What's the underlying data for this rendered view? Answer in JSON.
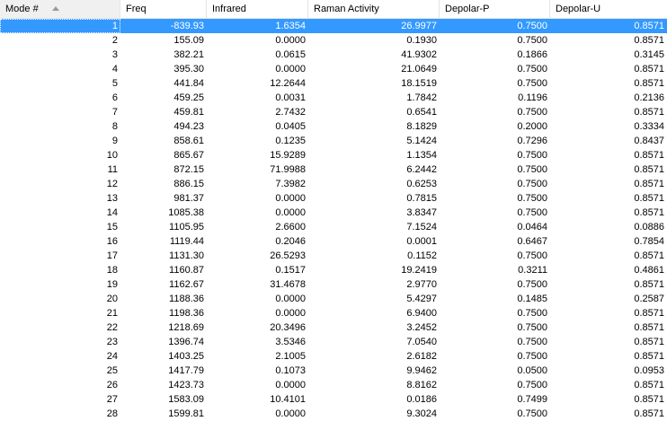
{
  "columns": [
    "Mode #",
    "Freq",
    "Infrared",
    "Raman Activity",
    "Depolar-P",
    "Depolar-U"
  ],
  "selected_row": 0,
  "rows": [
    [
      "1",
      "-839.93",
      "1.6354",
      "26.9977",
      "0.7500",
      "0.8571"
    ],
    [
      "2",
      "155.09",
      "0.0000",
      "0.1930",
      "0.7500",
      "0.8571"
    ],
    [
      "3",
      "382.21",
      "0.0615",
      "41.9302",
      "0.1866",
      "0.3145"
    ],
    [
      "4",
      "395.30",
      "0.0000",
      "21.0649",
      "0.7500",
      "0.8571"
    ],
    [
      "5",
      "441.84",
      "12.2644",
      "18.1519",
      "0.7500",
      "0.8571"
    ],
    [
      "6",
      "459.25",
      "0.0031",
      "1.7842",
      "0.1196",
      "0.2136"
    ],
    [
      "7",
      "459.81",
      "2.7432",
      "0.6541",
      "0.7500",
      "0.8571"
    ],
    [
      "8",
      "494.23",
      "0.0405",
      "8.1829",
      "0.2000",
      "0.3334"
    ],
    [
      "9",
      "858.61",
      "0.1235",
      "5.1424",
      "0.7296",
      "0.8437"
    ],
    [
      "10",
      "865.67",
      "15.9289",
      "1.1354",
      "0.7500",
      "0.8571"
    ],
    [
      "11",
      "872.15",
      "71.9988",
      "6.2442",
      "0.7500",
      "0.8571"
    ],
    [
      "12",
      "886.15",
      "7.3982",
      "0.6253",
      "0.7500",
      "0.8571"
    ],
    [
      "13",
      "981.37",
      "0.0000",
      "0.7815",
      "0.7500",
      "0.8571"
    ],
    [
      "14",
      "1085.38",
      "0.0000",
      "3.8347",
      "0.7500",
      "0.8571"
    ],
    [
      "15",
      "1105.95",
      "2.6600",
      "7.1524",
      "0.0464",
      "0.0886"
    ],
    [
      "16",
      "1119.44",
      "0.2046",
      "0.0001",
      "0.6467",
      "0.7854"
    ],
    [
      "17",
      "1131.30",
      "26.5293",
      "0.1152",
      "0.7500",
      "0.8571"
    ],
    [
      "18",
      "1160.87",
      "0.1517",
      "19.2419",
      "0.3211",
      "0.4861"
    ],
    [
      "19",
      "1162.67",
      "31.4678",
      "2.9770",
      "0.7500",
      "0.8571"
    ],
    [
      "20",
      "1188.36",
      "0.0000",
      "5.4297",
      "0.1485",
      "0.2587"
    ],
    [
      "21",
      "1198.36",
      "0.0000",
      "6.9400",
      "0.7500",
      "0.8571"
    ],
    [
      "22",
      "1218.69",
      "20.3496",
      "3.2452",
      "0.7500",
      "0.8571"
    ],
    [
      "23",
      "1396.74",
      "3.5346",
      "7.0540",
      "0.7500",
      "0.8571"
    ],
    [
      "24",
      "1403.25",
      "2.1005",
      "2.6182",
      "0.7500",
      "0.8571"
    ],
    [
      "25",
      "1417.79",
      "0.1073",
      "9.9462",
      "0.0500",
      "0.0953"
    ],
    [
      "26",
      "1423.73",
      "0.0000",
      "8.8162",
      "0.7500",
      "0.8571"
    ],
    [
      "27",
      "1583.09",
      "10.4101",
      "0.0186",
      "0.7499",
      "0.8571"
    ],
    [
      "28",
      "1599.81",
      "0.0000",
      "9.3024",
      "0.7500",
      "0.8571"
    ]
  ]
}
